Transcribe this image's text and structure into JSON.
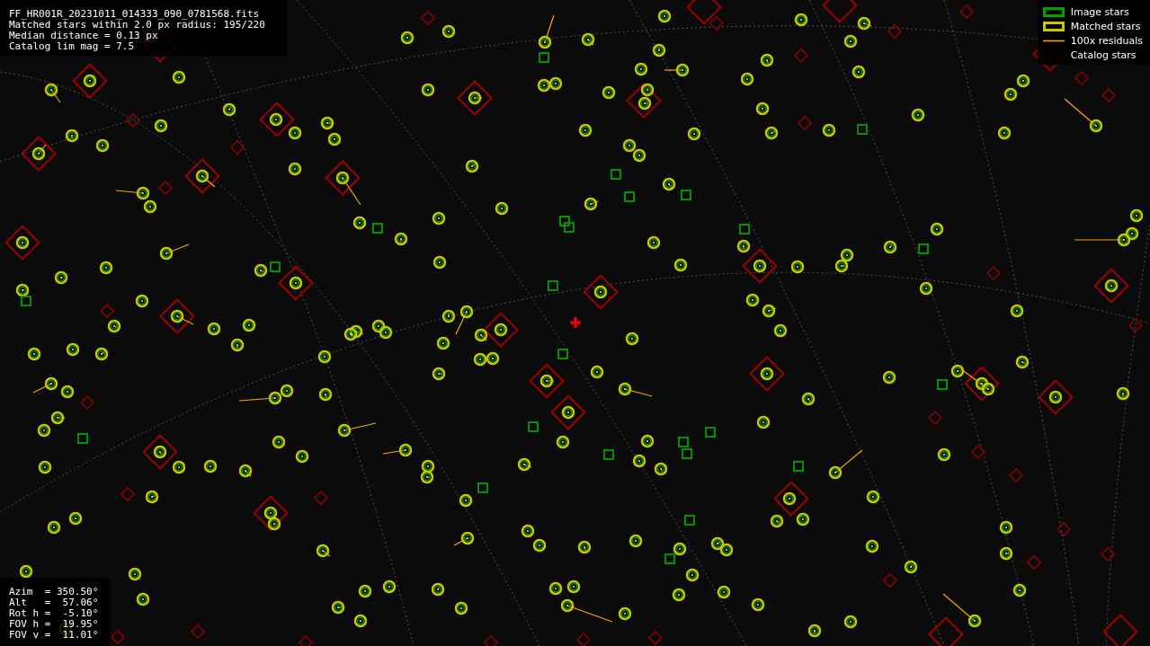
{
  "file_info": {
    "lines": [
      "FF_HR001R_20231011_014333_090_0781568.fits",
      "Matched stars within 2.0 px radius: 195/220",
      "Median distance = 0.13 px",
      "Catalog lim mag = 7.5"
    ]
  },
  "legend": {
    "items": [
      {
        "label": "Image stars",
        "kind": "box",
        "color": "#00a000"
      },
      {
        "label": "Matched stars",
        "kind": "box",
        "color": "#c8c800"
      },
      {
        "label": "100x residuals",
        "kind": "line",
        "color": "#ffa500"
      },
      {
        "label": "Catalog stars",
        "kind": "blank"
      }
    ]
  },
  "pointing": {
    "lines": [
      "Azim  = 350.50°",
      "Alt   =  57.06°",
      "Rot h =  -5.10°",
      "FOV h =  19.95°",
      "FOV v =  11.01°"
    ]
  }
}
